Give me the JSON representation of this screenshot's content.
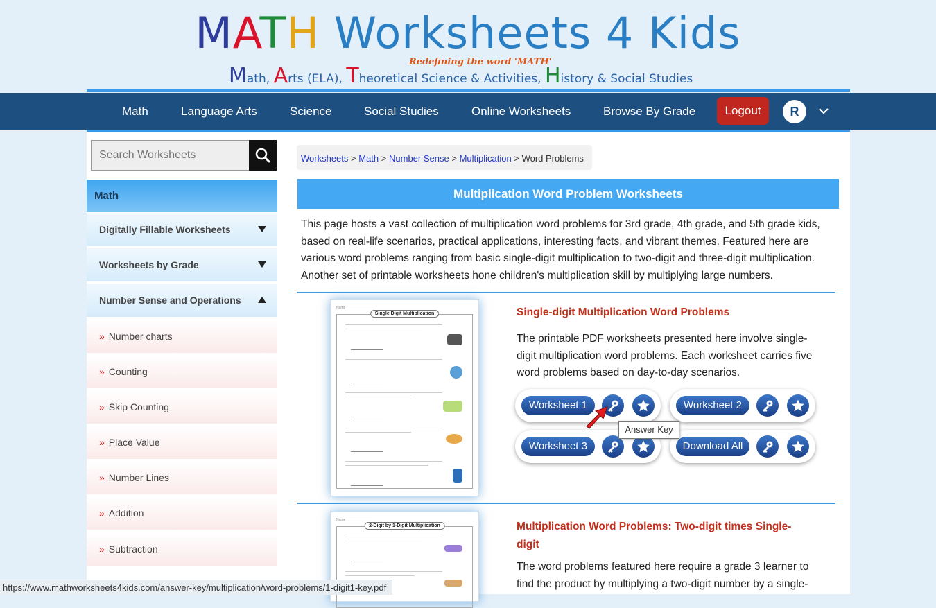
{
  "header": {
    "logo_word1_letters": [
      "M",
      "A",
      "T",
      "H"
    ],
    "logo_word2": "Worksheets 4 Kids",
    "tagline": "Redefining the word 'MATH'",
    "subtitle": {
      "m_letter": "M",
      "m_rest": "ath,",
      "a_letter": "A",
      "a_rest": "rts (ELA),",
      "t_letter": "T",
      "t_rest": "heoretical Science & Activities,",
      "h_letter": "H",
      "h_rest": "istory  & Social Studies"
    }
  },
  "nav": {
    "items": [
      "Math",
      "Language Arts",
      "Science",
      "Social Studies",
      "Online Worksheets",
      "Browse By Grade"
    ],
    "logout": "Logout",
    "avatar_initial": "R"
  },
  "search": {
    "placeholder": "Search Worksheets"
  },
  "sidebar": {
    "header": "Math",
    "categories": [
      "Digitally Fillable Worksheets",
      "Worksheets by Grade",
      "Number Sense and Operations"
    ],
    "subitems": [
      "Number charts",
      "Counting",
      "Skip Counting",
      "Place Value",
      "Number Lines",
      "Addition",
      "Subtraction"
    ]
  },
  "breadcrumb": {
    "links": [
      "Worksheets",
      "Math",
      "Number Sense",
      "Multiplication"
    ],
    "separator": ">",
    "current": "Word Problems"
  },
  "page_title": "Multiplication Word Problem Worksheets",
  "intro_text": "This page hosts a vast collection of multiplication word problems for 3rd grade, 4th grade, and 5th grade kids, based on real-life scenarios, practical applications, interesting facts, and vibrant themes. Featured here are various word problems ranging from basic single-digit multiplication to two-digit and three-digit multiplication. Another set of printable worksheets hone children's multiplication skill by multiplying large numbers.",
  "sections": [
    {
      "title": "Single-digit Multiplication Word Problems",
      "text": "The printable PDF worksheets presented here involve single-digit multiplication word problems. Each worksheet carries five word problems based on day-to-day scenarios.",
      "thumb_title": "Single Digit Multiplication",
      "buttons": [
        "Worksheet 1",
        "Worksheet 2",
        "Worksheet 3",
        "Download All"
      ]
    },
    {
      "title": "Multiplication Word Problems: Two-digit times Single-digit",
      "text": "The word problems featured here require a grade 3 learner to find the product by multiplying a two-digit number by a single-",
      "thumb_title": "2-Digit by 1-Digit Multiplication"
    }
  ],
  "tooltip": "Answer Key",
  "status_url": "https://www.mathworksheets4kids.com/answer-key/multiplication/word-problems/1-digit1-key.pdf",
  "icons": {
    "search": "search-icon",
    "key": "key-icon",
    "star": "star-icon",
    "chevron": "chevron-down-icon",
    "caret_down": "caret-down-icon",
    "caret_up": "caret-up-icon"
  }
}
